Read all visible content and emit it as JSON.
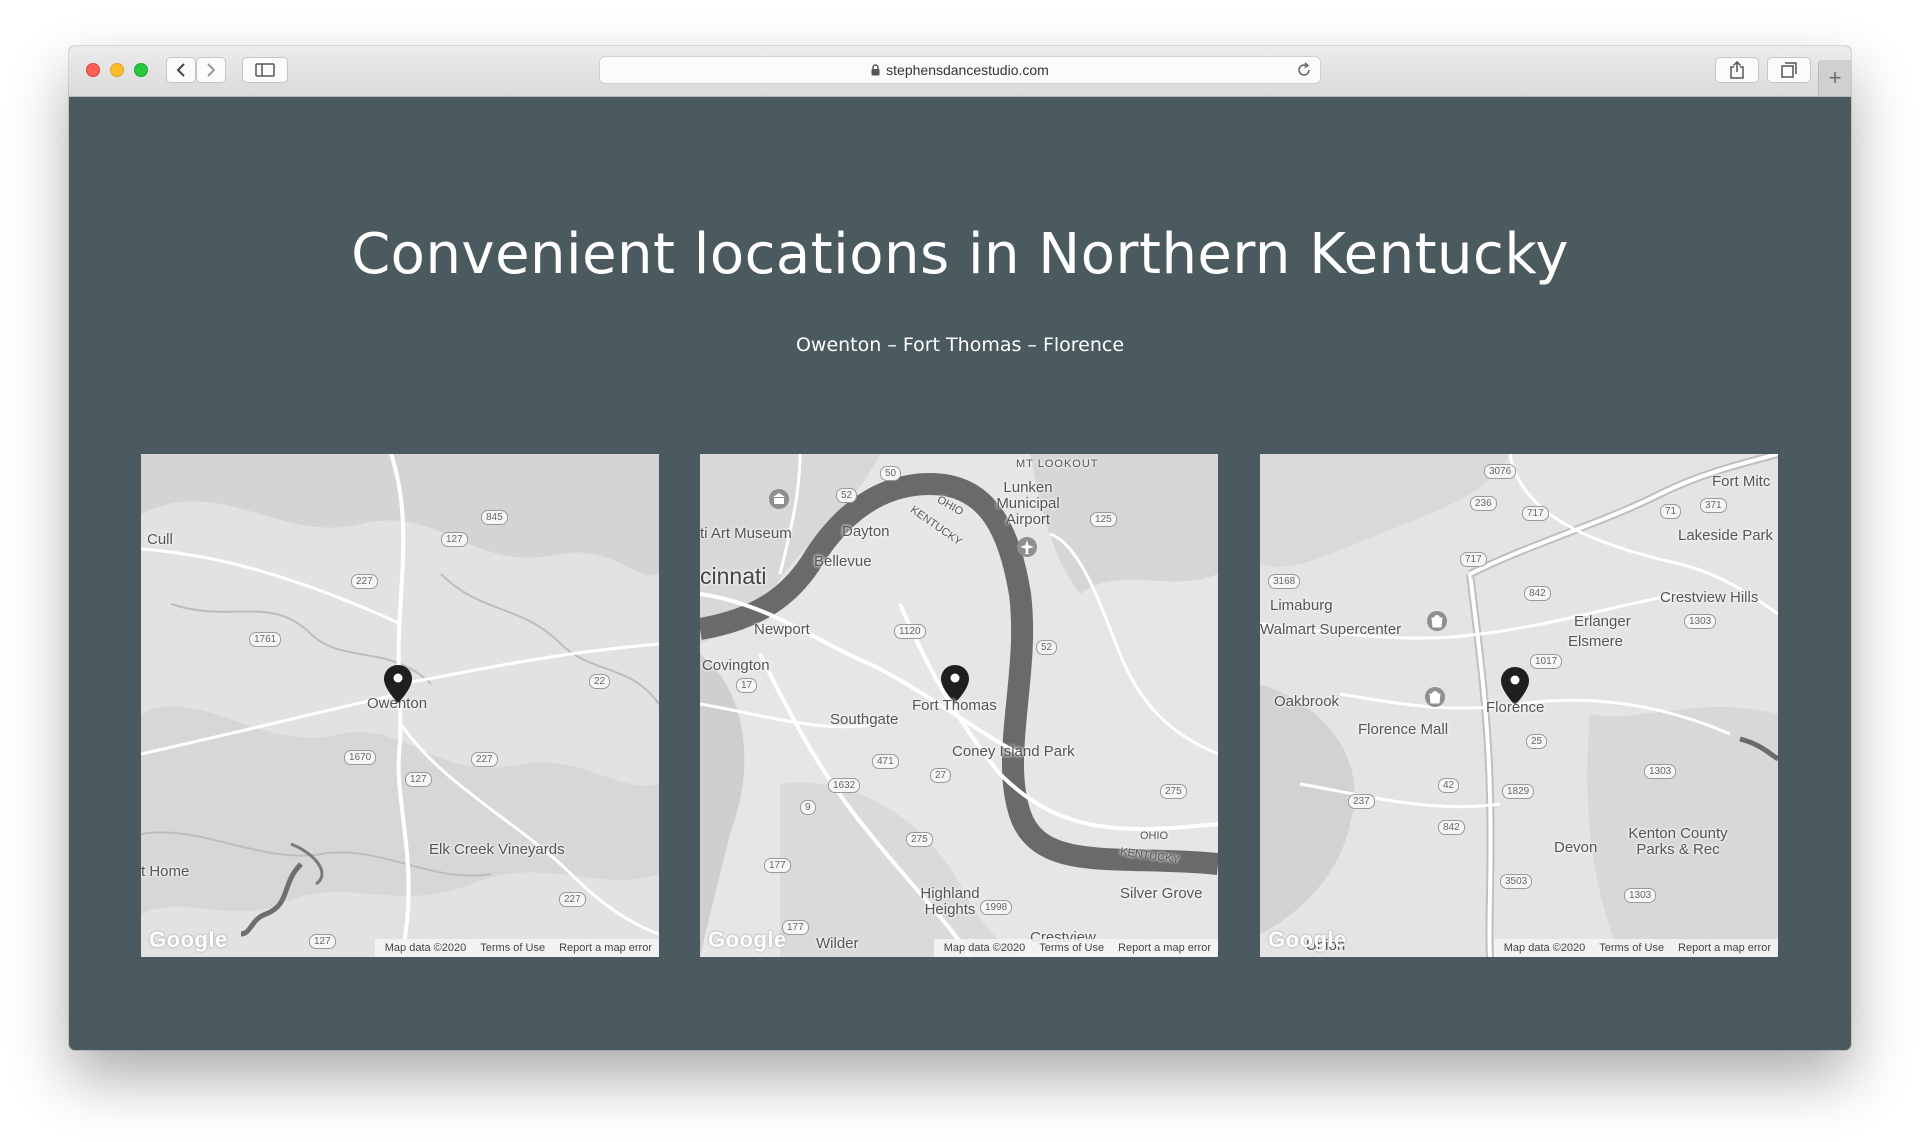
{
  "browser": {
    "url": "stephensdancestudio.com"
  },
  "page": {
    "headline": "Convenient locations in Northern Kentucky",
    "subtitle": "Owenton – Fort Thomas – Florence"
  },
  "attribution": {
    "map_data": "Map data ©2020",
    "terms": "Terms of Use",
    "report": "Report a map error",
    "logo": "Google"
  },
  "maps": [
    {
      "location": "Owenton",
      "places": [
        "Cull",
        "Elk Creek Vineyards",
        "t Home"
      ],
      "roads": [
        "845",
        "127",
        "227",
        "1761",
        "22",
        "1670",
        "227",
        "127",
        "227",
        "127"
      ]
    },
    {
      "location": "Fort Thomas",
      "places": [
        "ti Art Museum",
        "Dayton",
        "Bellevue",
        "cinnati",
        "Newport",
        "Covington",
        "Southgate",
        "Coney Island Park",
        "Lunken Municipal Airport",
        "Highland Heights",
        "Silver Grove",
        "Wilder",
        "Crestview",
        "MT LOOKOUT",
        "OHIO",
        "KENTUCKY",
        "OHIO",
        "KENTUCKY"
      ],
      "roads": [
        "50",
        "52",
        "125",
        "1120",
        "52",
        "17",
        "471",
        "27",
        "1632",
        "9",
        "275",
        "275",
        "177",
        "1998",
        "177"
      ]
    },
    {
      "location": "Florence",
      "places": [
        "Fort Mitc",
        "Lakeside Park",
        "Crestview Hills",
        "Limaburg",
        "Walmart Supercenter",
        "Erlanger",
        "Elsmere",
        "Oakbrook",
        "Florence Mall",
        "Devon",
        "Kenton County Parks & Rec",
        "Union"
      ],
      "roads": [
        "3076",
        "236",
        "717",
        "371",
        "71",
        "717",
        "3168",
        "842",
        "1303",
        "1017",
        "25",
        "42",
        "237",
        "1829",
        "842",
        "1303",
        "3503",
        "1303"
      ]
    }
  ]
}
